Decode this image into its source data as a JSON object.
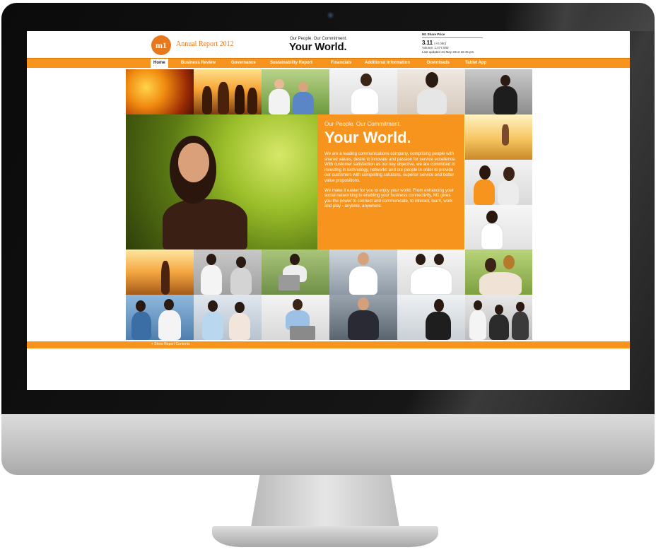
{
  "header": {
    "logo_text": "m1",
    "report_title": "Annual Report 2012",
    "tagline_small": "Our People. Our Commitment.",
    "tagline_big": "Your World."
  },
  "share_price": {
    "title": "M1 Share Price",
    "price": "3.11",
    "change": "(+0.050)",
    "volume": "Volume: 1,477,000",
    "updated": "Last updated 31 May 2013 15:45 pm"
  },
  "nav": {
    "items": [
      {
        "label": "Home",
        "active": true
      },
      {
        "label": "Business Review",
        "active": false
      },
      {
        "label": "Governance",
        "active": false
      },
      {
        "label": "Sustainability Report",
        "active": false
      },
      {
        "label": "Financials",
        "active": false
      },
      {
        "label": "Additional Information",
        "active": false
      },
      {
        "label": "Downloads",
        "active": false
      },
      {
        "label": "Tablet App",
        "active": false
      }
    ]
  },
  "hero": {
    "subtitle": "Our People. Our Commitment.",
    "title": "Your World.",
    "paragraph_1": "We are a leading communications company, comprising people with shared values, desire to innovate and passion for service excellence. With customer satisfaction as our key objective, we are committed to investing in technology, networks and our people in order to provide our customers with compelling solutions, superior service and better value propositions.",
    "paragraph_2": "We make it easier for you to enjoy your world. From enhancing your social networking to enabling your business connectivity, M1 gives you the power to connect and communicate, to interact, learn, work and play - anytime, anywhere."
  },
  "footer": {
    "link_label": "+ Show Report Contents"
  },
  "colors": {
    "brand_orange": "#f7941d",
    "logo_orange": "#e8781e"
  }
}
